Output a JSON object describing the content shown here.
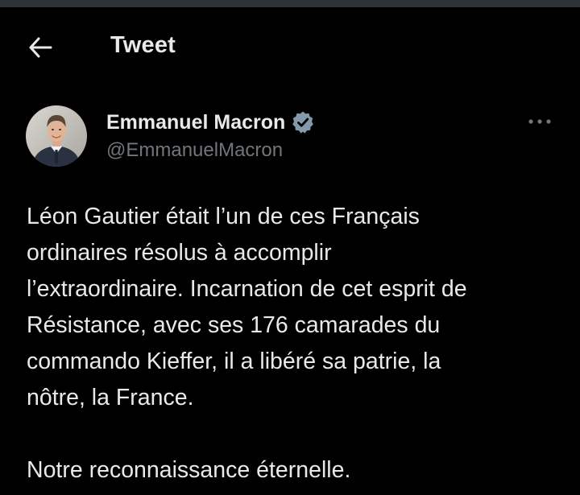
{
  "header": {
    "back_icon": "arrow-left-icon",
    "title": "Tweet"
  },
  "tweet": {
    "author": {
      "name": "Emmanuel Macron",
      "handle": "@EmmanuelMacron",
      "verified": true,
      "verified_icon": "verified-badge-icon",
      "avatar_icon": "avatar-photo"
    },
    "more_icon": "more-options-icon",
    "text_lines": [
      "Léon Gautier était l’un de ces Français",
      "ordinaires résolus à accomplir",
      "l’extraordinaire. Incarnation de cet esprit de",
      "Résistance, avec ses 176 camarades du",
      "commando Kieffer, il a libéré sa patrie, la",
      "nôtre, la France."
    ],
    "closing_line": "Notre reconnaissance éternelle."
  },
  "colors": {
    "background": "#000000",
    "text_primary": "#e7e9ea",
    "text_secondary": "#71767b",
    "verified_badge": "#829aab",
    "top_strip": "#2f3336"
  }
}
